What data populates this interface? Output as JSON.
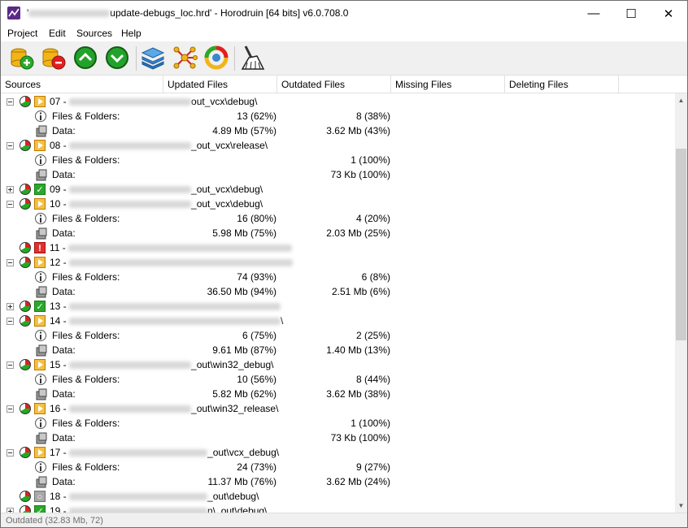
{
  "window": {
    "title_prefix": "'",
    "title_suffix": "update-debugs_loc.hrd' - Horodruin [64 bits] v6.0.708.0",
    "minimize_glyph": "—",
    "maximize_glyph": "☐",
    "close_glyph": "✕"
  },
  "menu": [
    "Project",
    "Edit",
    "Sources",
    "Help"
  ],
  "toolbar": {
    "icons": [
      "add-source-icon",
      "remove-source-icon",
      "move-up-icon",
      "move-down-icon",
      "layers-icon",
      "network-icon",
      "sync-icon",
      "clean-icon"
    ]
  },
  "columns": [
    "Sources",
    "Updated Files",
    "Outdated Files",
    "Missing Files",
    "Deleting Files"
  ],
  "labels": {
    "files": "Files & Folders:",
    "data": "Data:"
  },
  "rows": [
    {
      "kind": "src",
      "exp": "minus",
      "status": "play",
      "num": "07 -",
      "path": "out_vcx\\debug\\"
    },
    {
      "kind": "files",
      "updated": "13 (62%)",
      "outdated": "8 (38%)"
    },
    {
      "kind": "data",
      "updated": "4.89 Mb (57%)",
      "outdated": "3.62 Mb (43%)"
    },
    {
      "kind": "src",
      "exp": "minus",
      "status": "play",
      "num": "08 -",
      "path": "_out_vcx\\release\\"
    },
    {
      "kind": "files",
      "updated": "",
      "outdated": "1 (100%)"
    },
    {
      "kind": "data",
      "updated": "",
      "outdated": "73 Kb (100%)"
    },
    {
      "kind": "src",
      "exp": "plus",
      "status": "ok",
      "num": "09 -",
      "path": "_out_vcx\\debug\\"
    },
    {
      "kind": "src",
      "exp": "minus",
      "status": "play",
      "num": "10 -",
      "path": "_out_vcx\\debug\\"
    },
    {
      "kind": "files",
      "updated": "16 (80%)",
      "outdated": "4 (20%)"
    },
    {
      "kind": "data",
      "updated": "5.98 Mb (75%)",
      "outdated": "2.03 Mb (25%)"
    },
    {
      "kind": "src",
      "exp": "",
      "status": "err",
      "num": "11 -",
      "path": ""
    },
    {
      "kind": "src",
      "exp": "minus",
      "status": "play",
      "num": "12 -",
      "path": ""
    },
    {
      "kind": "files",
      "updated": "74 (93%)",
      "outdated": "6 (8%)"
    },
    {
      "kind": "data",
      "updated": "36.50 Mb (94%)",
      "outdated": "2.51 Mb (6%)"
    },
    {
      "kind": "src",
      "exp": "plus",
      "status": "ok",
      "num": "13 -",
      "path": ""
    },
    {
      "kind": "src",
      "exp": "minus",
      "status": "play",
      "num": "14 -",
      "path": "\\"
    },
    {
      "kind": "files",
      "updated": "6 (75%)",
      "outdated": "2 (25%)"
    },
    {
      "kind": "data",
      "updated": "9.61 Mb (87%)",
      "outdated": "1.40 Mb (13%)"
    },
    {
      "kind": "src",
      "exp": "minus",
      "status": "play",
      "num": "15 -",
      "path": "_out\\win32_debug\\"
    },
    {
      "kind": "files",
      "updated": "10 (56%)",
      "outdated": "8 (44%)"
    },
    {
      "kind": "data",
      "updated": "5.82 Mb (62%)",
      "outdated": "3.62 Mb (38%)"
    },
    {
      "kind": "src",
      "exp": "minus",
      "status": "play",
      "num": "16 -",
      "path": "_out\\win32_release\\"
    },
    {
      "kind": "files",
      "updated": "",
      "outdated": "1 (100%)"
    },
    {
      "kind": "data",
      "updated": "",
      "outdated": "73 Kb (100%)"
    },
    {
      "kind": "src",
      "exp": "minus",
      "status": "play",
      "num": "17 -",
      "path": "_out\\vcx_debug\\"
    },
    {
      "kind": "files",
      "updated": "24 (73%)",
      "outdated": "9 (27%)"
    },
    {
      "kind": "data",
      "updated": "11.37 Mb (76%)",
      "outdated": "3.62 Mb (24%)"
    },
    {
      "kind": "src",
      "exp": "",
      "status": "gray",
      "num": "18 -",
      "path": "_out\\debug\\"
    },
    {
      "kind": "src",
      "exp": "plus",
      "status": "ok",
      "num": "19 -",
      "path": "n\\_out\\debug\\"
    }
  ],
  "status_bar": "Outdated (32.83 Mb, 72)",
  "colors": {
    "accent": "#5b2a86",
    "ok": "#2aa82a",
    "error": "#e03030",
    "warning": "#f5c040"
  }
}
